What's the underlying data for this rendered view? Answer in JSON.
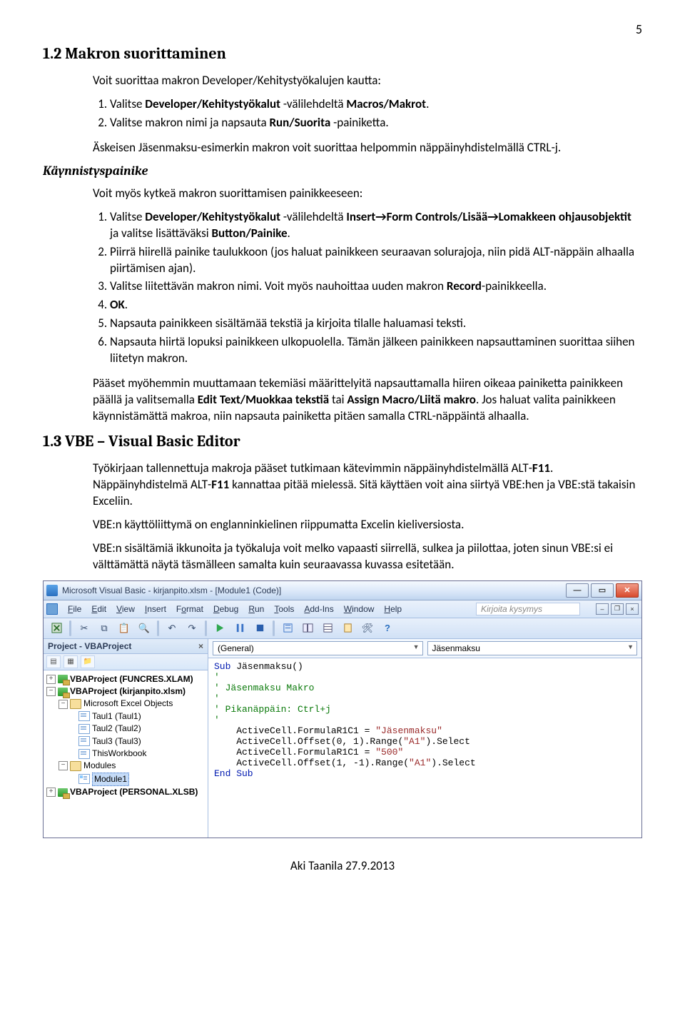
{
  "page_number": "5",
  "section12_title": "1.2 Makron suorittaminen",
  "p1": "Voit suorittaa makron Developer/Kehitystyökalujen kautta:",
  "list1": [
    "Valitse Developer/Kehitystyökalut -välilehdeltä Macros/Makrot.",
    "Valitse makron nimi ja napsauta Run/Suorita -painiketta."
  ],
  "p2_a": "Äskeisen Jäsenmaksu-esimerkin makron voit suorittaa helpommin näppäinyhdistelmällä ",
  "p2_b": "CTRL",
  "p2_c": "-j.",
  "italic_label": "Käynnistyspainike",
  "p3": "Voit myös kytkeä makron suorittamisen painikkeeseen:",
  "list2": [
    "Valitse Developer/Kehitystyökalut -välilehdeltä Insert→Form Controls/Lisää→Lomakkeen ohjausobjektit ja valitse lisättäväksi Button/Painike.",
    "Piirrä hiirellä painike taulukkoon (jos haluat painikkeen seuraavan solurajoja, niin pidä ALT-näppäin alhaalla piirtämisen ajan).",
    "Valitse liitettävän makron nimi. Voit myös nauhoittaa uuden makron Record-painikkeella.",
    "OK.",
    "Napsauta painikkeen sisältämää tekstiä ja kirjoita tilalle haluamasi teksti.",
    "Napsauta hiirtä lopuksi painikkeen ulkopuolella. Tämän jälkeen painikkeen napsauttaminen suorittaa siihen liitetyn makron."
  ],
  "p4_a": "Pääset myöhemmin muuttamaan tekemiäsi määrittelyitä napsauttamalla hiiren oikeaa painiketta painikkeen päällä ja valitsemalla ",
  "p4_b": "Edit Text/Muokkaa tekstiä",
  "p4_c": " tai ",
  "p4_d": "Assign Macro/Liitä makro",
  "p4_e": ". Jos haluat valita painikkeen käynnistämättä makroa, niin napsauta painiketta pitäen samalla ",
  "p4_f": "CTRL",
  "p4_g": "-näppäintä alhaalla.",
  "section13_title": "1.3 VBE – Visual Basic Editor",
  "p5_a": "Työkirjaan tallennettuja makroja pääset tutkimaan kätevimmin näppäinyhdistelmällä ",
  "p5_b": "ALT",
  "p5_c": "-",
  "p5_d": "F11",
  "p5_e": ". Näppäinyhdistelmä ",
  "p5_f": "ALT",
  "p5_g": "-",
  "p5_h": "F11",
  "p5_i": " kannattaa pitää mielessä. Sitä käyttäen voit aina siirtyä VBE:hen ja VBE:stä takaisin Exceliin.",
  "p6": "VBE:n käyttöliittymä on englanninkielinen riippumatta Excelin kieliversiosta.",
  "p7": "VBE:n sisältämiä ikkunoita ja työkaluja voit melko vapaasti siirrellä, sulkea ja piilottaa, joten sinun VBE:si ei välttämättä näytä täsmälleen samalta kuin seuraavassa kuvassa esitetään.",
  "vbe": {
    "title": "Microsoft Visual Basic - kirjanpito.xlsm - [Module1 (Code)]",
    "menu": [
      "File",
      "Edit",
      "View",
      "Insert",
      "Format",
      "Debug",
      "Run",
      "Tools",
      "Add-Ins",
      "Window",
      "Help"
    ],
    "ask_placeholder": "Kirjoita kysymys",
    "project_title": "Project - VBAProject",
    "tree": {
      "p1": "VBAProject (FUNCRES.XLAM)",
      "p2": "VBAProject (kirjanpito.xlsm)",
      "f1": "Microsoft Excel Objects",
      "s1": "Taul1 (Taul1)",
      "s2": "Taul2 (Taul2)",
      "s3": "Taul3 (Taul3)",
      "s4": "ThisWorkbook",
      "f2": "Modules",
      "m1": "Module1",
      "p3": "VBAProject (PERSONAL.XLSB)"
    },
    "dd_left": "(General)",
    "dd_right": "Jäsenmaksu",
    "code_lines": [
      {
        "t": "kw",
        "v": "Sub"
      },
      {
        "t": "",
        "v": " Jäsenmaksu()"
      },
      {
        "t": "nl"
      },
      {
        "t": "cm",
        "v": "'"
      },
      {
        "t": "nl"
      },
      {
        "t": "cm",
        "v": "' Jäsenmaksu Makro"
      },
      {
        "t": "nl"
      },
      {
        "t": "cm",
        "v": "'"
      },
      {
        "t": "nl"
      },
      {
        "t": "cm",
        "v": "' Pikanäppäin: Ctrl+j"
      },
      {
        "t": "nl"
      },
      {
        "t": "cm",
        "v": "'"
      },
      {
        "t": "nl"
      },
      {
        "t": "",
        "v": "    ActiveCell.FormulaR1C1 = "
      },
      {
        "t": "str",
        "v": "\"Jäsenmaksu\""
      },
      {
        "t": "nl"
      },
      {
        "t": "",
        "v": "    ActiveCell.Offset(0, 1).Range("
      },
      {
        "t": "str",
        "v": "\"A1\""
      },
      {
        "t": "",
        "v": ").Select"
      },
      {
        "t": "nl"
      },
      {
        "t": "",
        "v": "    ActiveCell.FormulaR1C1 = "
      },
      {
        "t": "str",
        "v": "\"500\""
      },
      {
        "t": "nl"
      },
      {
        "t": "",
        "v": "    ActiveCell.Offset(1, -1).Range("
      },
      {
        "t": "str",
        "v": "\"A1\""
      },
      {
        "t": "",
        "v": ").Select"
      },
      {
        "t": "nl"
      },
      {
        "t": "kw",
        "v": "End Sub"
      }
    ]
  },
  "footer": "Aki Taanila 27.9.2013"
}
